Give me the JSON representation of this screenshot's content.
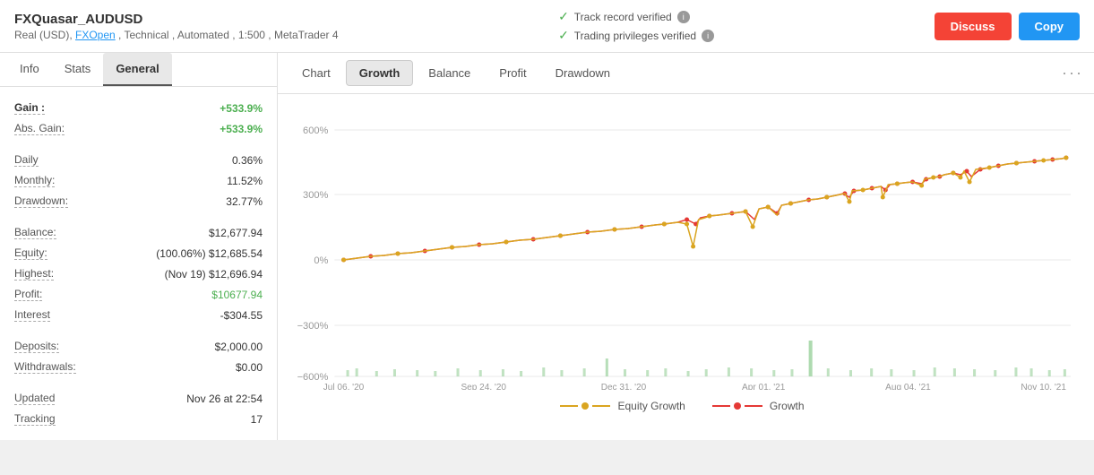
{
  "header": {
    "title": "FXQuasar_AUDUSD",
    "subtitle": "Real (USD), FXOpen , Technical , Automated , 1:500 , MetaTrader 4",
    "fx_open_link": "FXOpen",
    "track_record": "Track record verified",
    "trading_privileges": "Trading privileges verified",
    "discuss_label": "Discuss",
    "copy_label": "Copy"
  },
  "left_tabs": [
    {
      "id": "info",
      "label": "Info"
    },
    {
      "id": "stats",
      "label": "Stats"
    },
    {
      "id": "general",
      "label": "General",
      "active": true
    }
  ],
  "stats": {
    "gain_label": "Gain :",
    "gain_value": "+533.9%",
    "abs_gain_label": "Abs. Gain:",
    "abs_gain_value": "+533.9%",
    "daily_label": "Daily",
    "daily_value": "0.36%",
    "monthly_label": "Monthly:",
    "monthly_value": "11.52%",
    "drawdown_label": "Drawdown:",
    "drawdown_value": "32.77%",
    "balance_label": "Balance:",
    "balance_value": "$12,677.94",
    "equity_label": "Equity:",
    "equity_value": "(100.06%) $12,685.54",
    "highest_label": "Highest:",
    "highest_value": "(Nov 19) $12,696.94",
    "profit_label": "Profit:",
    "profit_value": "$10677.94",
    "interest_label": "Interest",
    "interest_value": "-$304.55",
    "deposits_label": "Deposits:",
    "deposits_value": "$2,000.00",
    "withdrawals_label": "Withdrawals:",
    "withdrawals_value": "$0.00",
    "updated_label": "Updated",
    "updated_value": "Nov 26 at 22:54",
    "tracking_label": "Tracking",
    "tracking_value": "17"
  },
  "chart_tabs": [
    {
      "id": "chart",
      "label": "Chart"
    },
    {
      "id": "growth",
      "label": "Growth",
      "active": true
    },
    {
      "id": "balance",
      "label": "Balance"
    },
    {
      "id": "profit",
      "label": "Profit"
    },
    {
      "id": "drawdown",
      "label": "Drawdown"
    }
  ],
  "chart": {
    "y_labels": [
      "600%",
      "300%",
      "0%",
      "-300%",
      "-600%"
    ],
    "x_labels": [
      "Jul 06, '20",
      "Sep 24, '20",
      "Dec 31, '20",
      "Apr 01, '21",
      "Aug 04, '21",
      "Nov 10, '21"
    ],
    "legend": {
      "equity_label": "Equity Growth",
      "growth_label": "Growth"
    }
  }
}
